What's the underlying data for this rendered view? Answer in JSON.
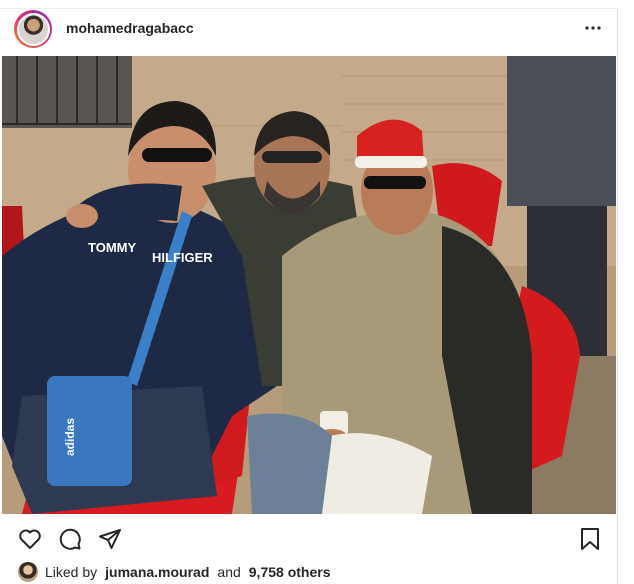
{
  "post": {
    "username": "mohamedragabacc",
    "more_icon": "more-horizontal-icon",
    "photo_description_visible": false,
    "actions": {
      "like_icon": "heart-icon",
      "comment_icon": "comment-icon",
      "share_icon": "send-icon",
      "save_icon": "bookmark-icon"
    },
    "likes": {
      "prefix": "Liked by",
      "user": "jumana.mourad",
      "conjunction": "and",
      "others": "9,758 others"
    },
    "photo_text": {
      "sweater_brand_left": "TOMMY",
      "sweater_brand_right": "HILFIGER",
      "bag_brand": "adidas"
    }
  },
  "colors": {
    "text": "#262626",
    "avatar_ring_start": "#f58529",
    "avatar_ring_end": "#8134af",
    "border": "#dbdbdb"
  }
}
